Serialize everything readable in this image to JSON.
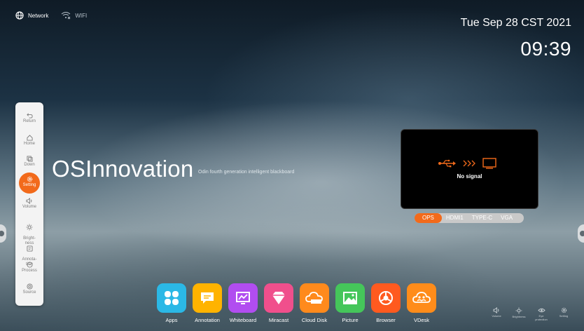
{
  "status": {
    "network": "Network",
    "wifi": "WIFI"
  },
  "clock": {
    "date": "Tue Sep 28 CST 2021",
    "time": "09:39"
  },
  "sidebar": {
    "items": [
      {
        "label": "Return",
        "icon": "return-icon"
      },
      {
        "label": "Home",
        "icon": "home-icon"
      },
      {
        "label": "Down",
        "icon": "down-icon"
      },
      {
        "label": "Setting",
        "icon": "gear-icon",
        "active": true
      },
      {
        "label": "Volume",
        "icon": "volume-icon"
      },
      {
        "label": "Bright-\nness",
        "icon": "brightness-icon"
      },
      {
        "label": "Annota-\ntion",
        "icon": "annotation-icon"
      },
      {
        "label": "Process",
        "icon": "process-icon"
      },
      {
        "label": "Source",
        "icon": "source-icon"
      }
    ]
  },
  "brand": {
    "name": "OSInnovation",
    "tagline": "Odin fourth generation intelligent blackboard"
  },
  "preview": {
    "message": "No signal"
  },
  "sources": {
    "items": [
      "OPS",
      "HDMI1",
      "TYPE-C",
      "VGA"
    ],
    "active": "OPS"
  },
  "dock": {
    "apps": [
      {
        "label": "Apps",
        "color": "#2bb8e6"
      },
      {
        "label": "Annotation",
        "color": "#ffb300"
      },
      {
        "label": "Whiteboard",
        "color": "#b14df0"
      },
      {
        "label": "Miracast",
        "color": "#f04f8c"
      },
      {
        "label": "Cloud Disk",
        "color": "#ff8a1c"
      },
      {
        "label": "Picture",
        "color": "#45c65a"
      },
      {
        "label": "Browser",
        "color": "#ff5a1f"
      },
      {
        "label": "VDesk",
        "color": "#ff8c1a"
      }
    ]
  },
  "quick": {
    "items": [
      "Volume",
      "Brightness",
      "Eye protection",
      "Setting"
    ]
  },
  "colors": {
    "accent": "#f26a1b",
    "sidebar_bg": "#f3f3f3"
  }
}
